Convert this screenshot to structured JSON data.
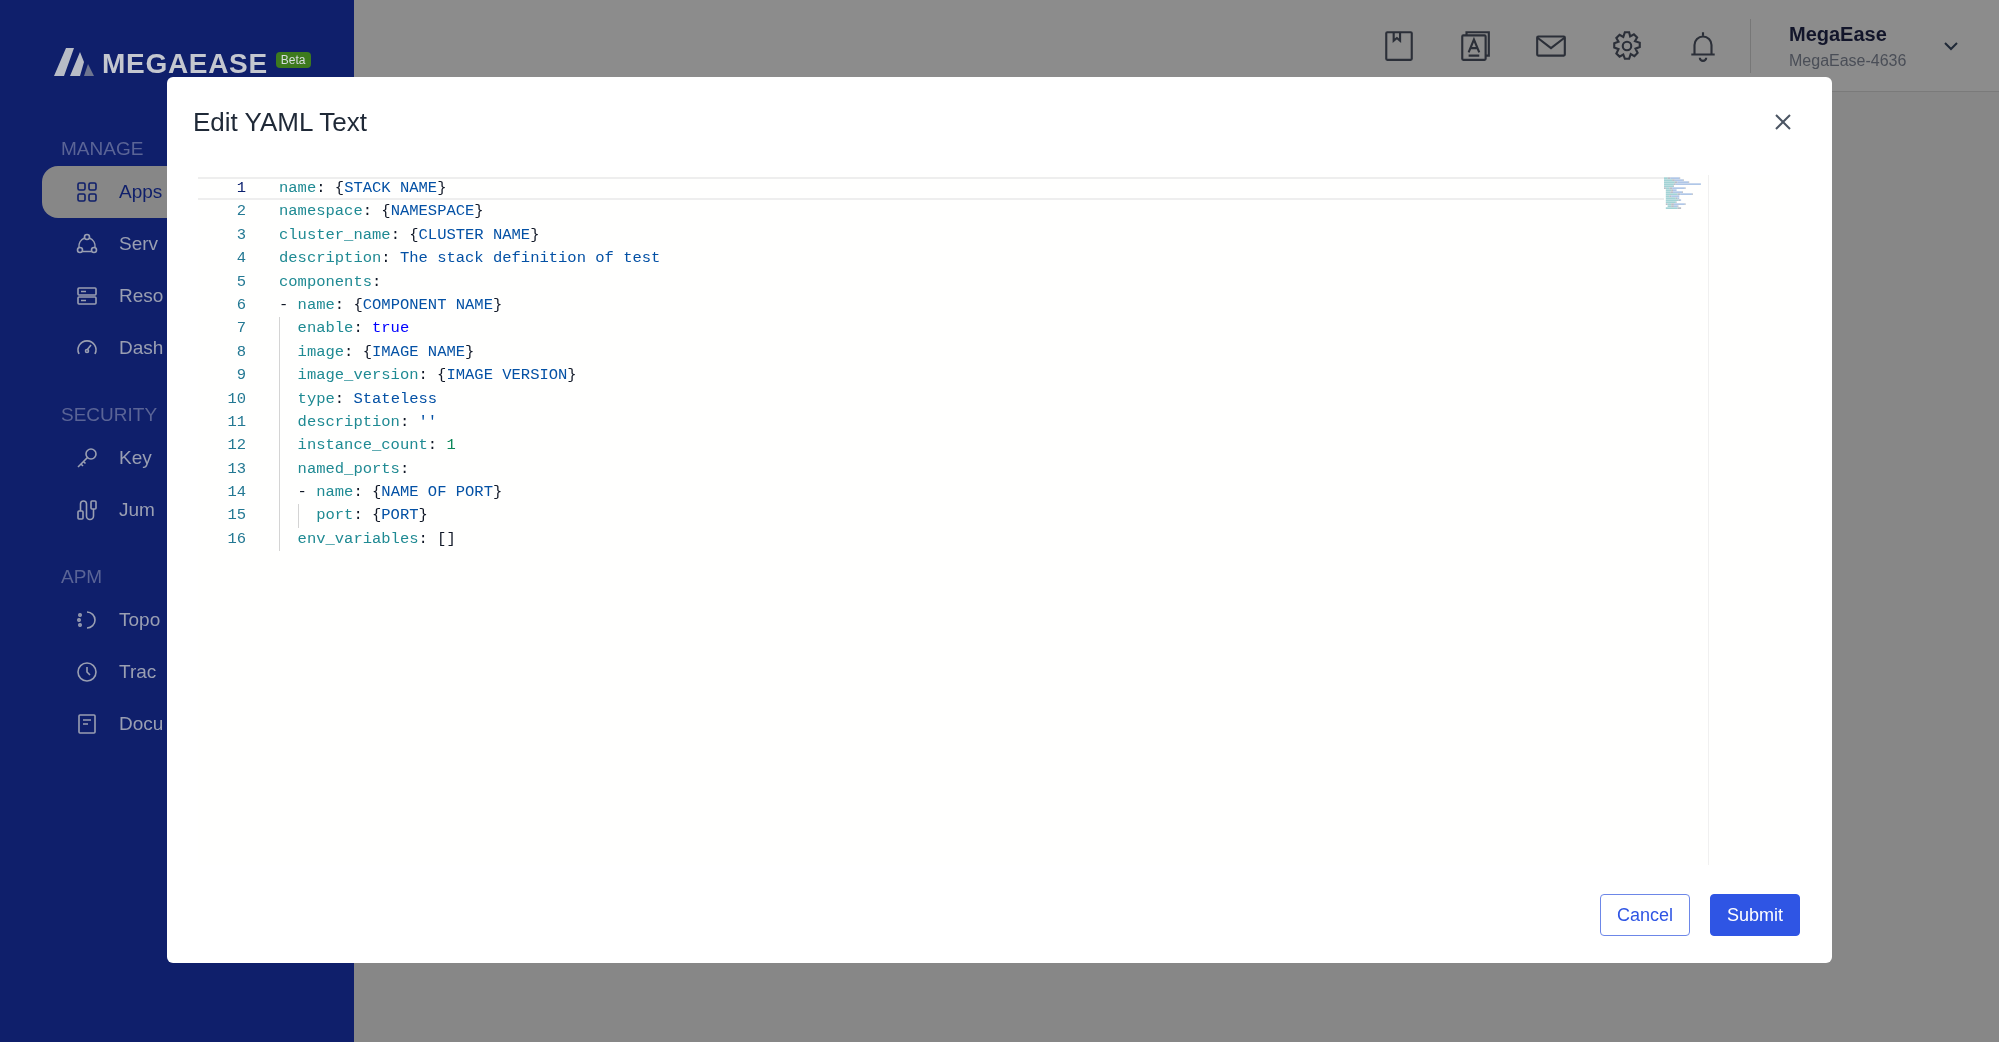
{
  "brand": {
    "name": "MEGAEASE",
    "badge": "Beta"
  },
  "sidebar": {
    "sections": [
      {
        "title": "MANAGE",
        "items": [
          {
            "label": "Apps",
            "selected": true
          },
          {
            "label": "Serv",
            "selected": false
          },
          {
            "label": "Reso",
            "selected": false
          },
          {
            "label": "Dash",
            "selected": false
          }
        ]
      },
      {
        "title": "SECURITY",
        "items": [
          {
            "label": "Key",
            "selected": false
          },
          {
            "label": "Jum",
            "selected": false
          }
        ]
      },
      {
        "title": "APM",
        "items": [
          {
            "label": "Topo",
            "selected": false
          },
          {
            "label": "Trac",
            "selected": false
          },
          {
            "label": "Docu",
            "selected": false
          }
        ]
      }
    ]
  },
  "header": {
    "user": {
      "name": "MegaEase",
      "account": "MegaEase-4636"
    }
  },
  "dialog": {
    "title": "Edit YAML Text",
    "editor": {
      "lines": [
        {
          "number": "1",
          "current": true,
          "tokens": [
            {
              "kind": "key",
              "text": "name"
            },
            {
              "kind": "punct",
              "text": ": {"
            },
            {
              "kind": "string",
              "text": "STACK NAME"
            },
            {
              "kind": "punct",
              "text": "}"
            }
          ]
        },
        {
          "number": "2",
          "current": false,
          "tokens": [
            {
              "kind": "key",
              "text": "namespace"
            },
            {
              "kind": "punct",
              "text": ": {"
            },
            {
              "kind": "string",
              "text": "NAMESPACE"
            },
            {
              "kind": "punct",
              "text": "}"
            }
          ]
        },
        {
          "number": "3",
          "current": false,
          "tokens": [
            {
              "kind": "key",
              "text": "cluster_name"
            },
            {
              "kind": "punct",
              "text": ": {"
            },
            {
              "kind": "string",
              "text": "CLUSTER NAME"
            },
            {
              "kind": "punct",
              "text": "}"
            }
          ]
        },
        {
          "number": "4",
          "current": false,
          "tokens": [
            {
              "kind": "key",
              "text": "description"
            },
            {
              "kind": "punct",
              "text": ": "
            },
            {
              "kind": "string",
              "text": "The stack definition of test"
            }
          ]
        },
        {
          "number": "5",
          "current": false,
          "tokens": [
            {
              "kind": "key",
              "text": "components"
            },
            {
              "kind": "punct",
              "text": ":"
            }
          ]
        },
        {
          "number": "6",
          "current": false,
          "tokens": [
            {
              "kind": "punct",
              "text": "- "
            },
            {
              "kind": "key",
              "text": "name"
            },
            {
              "kind": "punct",
              "text": ": {"
            },
            {
              "kind": "string",
              "text": "COMPONENT NAME"
            },
            {
              "kind": "punct",
              "text": "}"
            }
          ]
        },
        {
          "number": "7",
          "current": false,
          "tokens": [
            {
              "kind": "indent"
            },
            {
              "kind": "key",
              "text": "enable"
            },
            {
              "kind": "punct",
              "text": ": "
            },
            {
              "kind": "bool",
              "text": "true"
            }
          ]
        },
        {
          "number": "8",
          "current": false,
          "tokens": [
            {
              "kind": "indent"
            },
            {
              "kind": "key",
              "text": "image"
            },
            {
              "kind": "punct",
              "text": ": {"
            },
            {
              "kind": "string",
              "text": "IMAGE NAME"
            },
            {
              "kind": "punct",
              "text": "}"
            }
          ]
        },
        {
          "number": "9",
          "current": false,
          "tokens": [
            {
              "kind": "indent"
            },
            {
              "kind": "key",
              "text": "image_version"
            },
            {
              "kind": "punct",
              "text": ": {"
            },
            {
              "kind": "string",
              "text": "IMAGE VERSION"
            },
            {
              "kind": "punct",
              "text": "}"
            }
          ]
        },
        {
          "number": "10",
          "current": false,
          "tokens": [
            {
              "kind": "indent"
            },
            {
              "kind": "key",
              "text": "type"
            },
            {
              "kind": "punct",
              "text": ": "
            },
            {
              "kind": "string",
              "text": "Stateless"
            }
          ]
        },
        {
          "number": "11",
          "current": false,
          "tokens": [
            {
              "kind": "indent"
            },
            {
              "kind": "key",
              "text": "description"
            },
            {
              "kind": "punct",
              "text": ": "
            },
            {
              "kind": "string",
              "text": "''"
            }
          ]
        },
        {
          "number": "12",
          "current": false,
          "tokens": [
            {
              "kind": "indent"
            },
            {
              "kind": "key",
              "text": "instance_count"
            },
            {
              "kind": "punct",
              "text": ": "
            },
            {
              "kind": "number",
              "text": "1"
            }
          ]
        },
        {
          "number": "13",
          "current": false,
          "tokens": [
            {
              "kind": "indent"
            },
            {
              "kind": "key",
              "text": "named_ports"
            },
            {
              "kind": "punct",
              "text": ":"
            }
          ]
        },
        {
          "number": "14",
          "current": false,
          "tokens": [
            {
              "kind": "indent"
            },
            {
              "kind": "punct",
              "text": "- "
            },
            {
              "kind": "key",
              "text": "name"
            },
            {
              "kind": "punct",
              "text": ": {"
            },
            {
              "kind": "string",
              "text": "NAME OF PORT"
            },
            {
              "kind": "punct",
              "text": "}"
            }
          ]
        },
        {
          "number": "15",
          "current": false,
          "tokens": [
            {
              "kind": "indent"
            },
            {
              "kind": "indent"
            },
            {
              "kind": "key",
              "text": "port"
            },
            {
              "kind": "punct",
              "text": ": {"
            },
            {
              "kind": "string",
              "text": "PORT"
            },
            {
              "kind": "punct",
              "text": "}"
            }
          ]
        },
        {
          "number": "16",
          "current": false,
          "tokens": [
            {
              "kind": "indent"
            },
            {
              "kind": "key",
              "text": "env_variables"
            },
            {
              "kind": "punct",
              "text": ": []"
            }
          ]
        }
      ]
    },
    "buttons": [
      {
        "label": "Cancel",
        "kind": "secondary"
      },
      {
        "label": "Submit",
        "kind": "primary"
      }
    ]
  }
}
